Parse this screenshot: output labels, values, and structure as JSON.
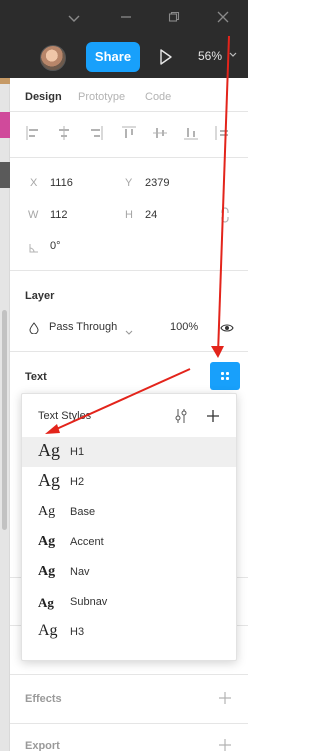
{
  "titlebar": {
    "icons": [
      "chevron-down-icon",
      "minimize-icon",
      "restore-icon",
      "close-icon"
    ]
  },
  "toolbar": {
    "share_label": "Share",
    "zoom": "56%"
  },
  "tabs": [
    "Design",
    "Prototype",
    "Code"
  ],
  "properties": {
    "x_label": "X",
    "x_value": "1116",
    "y_label": "Y",
    "y_value": "2379",
    "w_label": "W",
    "w_value": "112",
    "h_label": "H",
    "h_value": "24",
    "rotation_value": "0°"
  },
  "layer": {
    "title": "Layer",
    "blend_mode": "Pass Through",
    "opacity": "100%"
  },
  "text_section": {
    "title": "Text"
  },
  "text_styles_popup": {
    "title": "Text Styles",
    "items": [
      {
        "sample": "Ag",
        "label": "H1",
        "selected": true
      },
      {
        "sample": "Ag",
        "label": "H2",
        "selected": false
      },
      {
        "sample": "Ag",
        "label": "Base",
        "selected": false
      },
      {
        "sample": "Ag",
        "label": "Accent",
        "selected": false
      },
      {
        "sample": "Ag",
        "label": "Nav",
        "selected": false
      },
      {
        "sample": "Ag",
        "label": "Subnav",
        "selected": false
      },
      {
        "sample": "Ag",
        "label": "H3",
        "selected": false
      }
    ]
  },
  "effects": {
    "title": "Effects"
  },
  "export": {
    "title": "Export"
  },
  "colors": {
    "accent": "#18a0fb",
    "toolbar_bg": "#2c2c2c",
    "annotation_arrow": "#e3241b"
  }
}
